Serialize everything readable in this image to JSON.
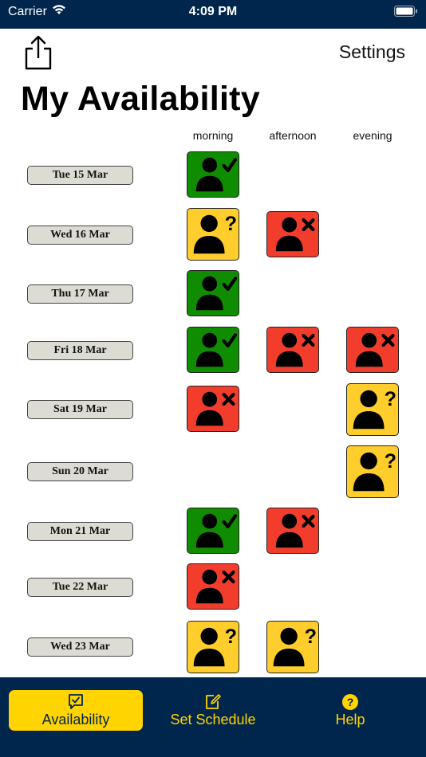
{
  "status_bar": {
    "carrier": "Carrier",
    "time": "4:09 PM"
  },
  "header": {
    "settings_label": "Settings",
    "title": "My Availability"
  },
  "columns": [
    "morning",
    "afternoon",
    "evening"
  ],
  "days": [
    {
      "date": "Tue 15 Mar",
      "slots": [
        "yes",
        null,
        null
      ]
    },
    {
      "date": "Wed 16 Mar",
      "slots": [
        "maybe",
        "no",
        null
      ]
    },
    {
      "date": "Thu 17 Mar",
      "slots": [
        "yes",
        null,
        null
      ]
    },
    {
      "date": "Fri 18 Mar",
      "slots": [
        "yes",
        "no",
        "no"
      ]
    },
    {
      "date": "Sat 19 Mar",
      "slots": [
        "no",
        null,
        "maybe"
      ]
    },
    {
      "date": "Sun 20 Mar",
      "slots": [
        null,
        null,
        "maybe"
      ]
    },
    {
      "date": "Mon 21 Mar",
      "slots": [
        "yes",
        "no",
        null
      ]
    },
    {
      "date": "Tue 22 Mar",
      "slots": [
        "no",
        null,
        null
      ]
    },
    {
      "date": "Wed 23 Mar",
      "slots": [
        "maybe",
        "maybe",
        null
      ]
    }
  ],
  "tabs": [
    {
      "label": "Availability",
      "icon": "speech-bubble-check-icon",
      "active": true
    },
    {
      "label": "Set Schedule",
      "icon": "edit-square-icon",
      "active": false
    },
    {
      "label": "Help",
      "icon": "question-circle-icon",
      "active": false
    }
  ],
  "colors": {
    "bar_background": "#00264d",
    "accent": "#ffd400",
    "available": "#0f8c00",
    "unavailable": "#f23d2d",
    "maybe": "#ffcd2c"
  }
}
